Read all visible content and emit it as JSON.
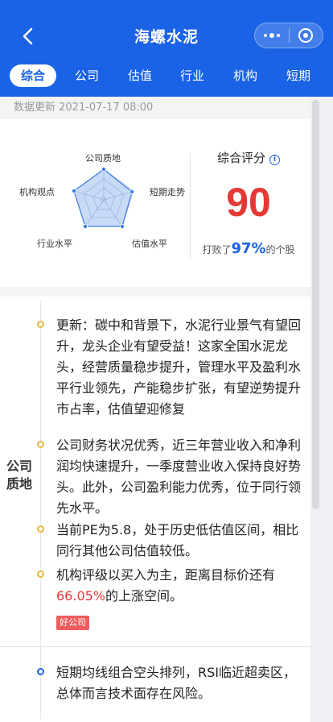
{
  "header": {
    "title": "海螺水泥",
    "back_icon": "chevron-left-icon",
    "more_icon": "more-dots-icon",
    "close_icon": "target-icon",
    "color": "#1a62e6"
  },
  "tabs": [
    {
      "label": "综合",
      "active": true
    },
    {
      "label": "公司",
      "active": false
    },
    {
      "label": "估值",
      "active": false
    },
    {
      "label": "行业",
      "active": false
    },
    {
      "label": "机构",
      "active": false
    },
    {
      "label": "短期",
      "active": false
    }
  ],
  "update_text": "数据更新 2021-07-17 08:00",
  "radar": {
    "labels": [
      "公司质地",
      "短期走势",
      "估值水平",
      "行业水平",
      "机构观点"
    ]
  },
  "score": {
    "title": "综合评分",
    "info_icon": "info-icon",
    "value": "90",
    "beat_prefix": "打败了",
    "beat_pct": "97%",
    "beat_suffix": "的个股"
  },
  "section": {
    "label": "公司质地",
    "items": [
      "更新：碳中和背景下，水泥行业景气有望回升，龙头企业有望受益！这家全国水泥龙头，经营质量稳步提升，管理水平及盈利水平行业领先，产能稳步扩张，有望逆势提升市占率，估值望迎修复",
      "公司财务状况优秀，近三年营业收入和净利润均快速提升，一季度营业收入保持良好势头。此外，公司盈利能力优秀，位于同行领先水平。",
      "当前PE为5.8，处于历史低估值区间，相比同行其他公司估值较低。"
    ],
    "item4_prefix": "机构评级以买入为主，距离目标价还有",
    "item4_highlight": "66.05%",
    "item4_suffix": "的上涨空间。",
    "badge": "好公司"
  },
  "next_section": {
    "item": "短期均线组合空头排列，RSI临近超卖区，总体而言技术面存在风险。"
  }
}
